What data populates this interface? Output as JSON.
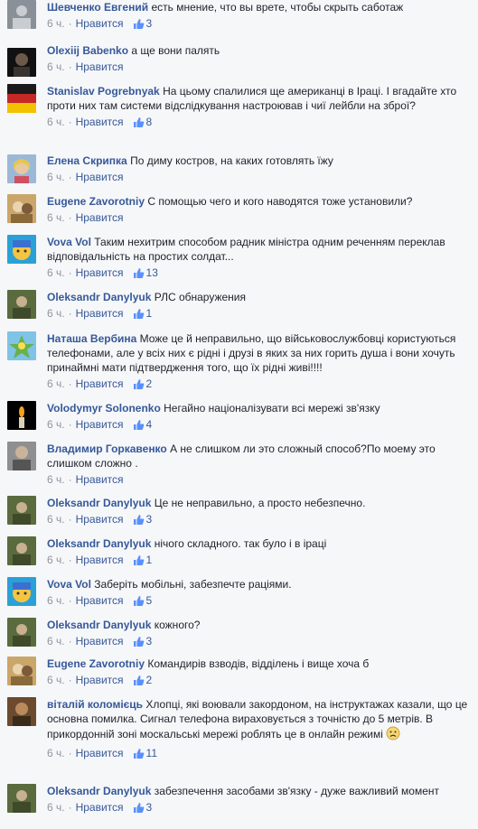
{
  "labels": {
    "like": "Нравится",
    "time": "6 ч.",
    "sep": "·"
  },
  "colors": {
    "link": "#365899",
    "meta": "#90949c",
    "text": "#1d2129",
    "background": "#f6f7f9"
  },
  "icons": {
    "like": "thumbs-up-icon",
    "emoji": "sad-face-emoji-icon"
  },
  "comments": [
    {
      "author": "Шевченко Евгений",
      "text": "есть мнение, что вы врете, чтобы скрыть саботаж",
      "likes": "3"
    },
    {
      "author": "Olexiij Babenko",
      "text": "а ще вони палять",
      "likes": ""
    },
    {
      "author": "Stanislav Pogrebnyak",
      "text": "На цьому спалилися ще американці в Іраці. І вгадайте хто проти них там системи відслідкування настроював і чиї лейбли на зброї?",
      "likes": "8"
    },
    {
      "author": "Елена Скрипка",
      "text": "По диму костров, на каких готовлять їжу",
      "likes": ""
    },
    {
      "author": "Eugene Zavorotniy",
      "text": "С помощью чего и кого наводятся тоже установили?",
      "likes": ""
    },
    {
      "author": "Vova Vol",
      "text": "Таким нехитрим способом радник міністра одним реченням переклав відповідальність на простих солдат...",
      "likes": "13"
    },
    {
      "author": "Oleksandr Danylyuk",
      "text": "РЛС обнаружения",
      "likes": "1"
    },
    {
      "author": "Наташа Вербина",
      "text": "Може це й неправильно, що військовослужбовці користуються телефонами, але у всіх них є рідні і друзі в яких за них горить душа і вони хочуть принаймні мати підтвердження того, що їх рідні живі!!!!",
      "likes": "2"
    },
    {
      "author": "Volodymyr Solonenko",
      "text": "Негайно націоналізувати всі мережі зв'язку",
      "likes": "4"
    },
    {
      "author": "Владимир Горкавенко",
      "text": "А не слишком ли это сложный способ?По моему это слишком сложно .",
      "likes": ""
    },
    {
      "author": "Oleksandr Danylyuk",
      "text": "Це не неправильно, а просто небезпечно.",
      "likes": "3"
    },
    {
      "author": "Oleksandr Danylyuk",
      "text": "нічого складного. так було і в іраці",
      "likes": "1"
    },
    {
      "author": "Vova Vol",
      "text": "Заберіть мобільні, забезпечте раціями.",
      "likes": "5"
    },
    {
      "author": "Oleksandr Danylyuk",
      "text": "кожного?",
      "likes": "3"
    },
    {
      "author": "Eugene Zavorotniy",
      "text": "Командирів взводів, відділень і вище хоча б",
      "likes": "2"
    },
    {
      "author": "віталій коломієць",
      "text": "Хлопці, які воювали закордоном, на інструктажах казали, що це основна помилка. Сигнал телефона вираховується з точністю до 5 метрів. В прикордонній зоні москальські мережі роблять це в онлайн режимі",
      "likes": "11"
    },
    {
      "author": "Oleksandr Danylyuk",
      "text": "забезпечення засобами зв'язку - дуже важливий момент",
      "likes": "3"
    }
  ]
}
